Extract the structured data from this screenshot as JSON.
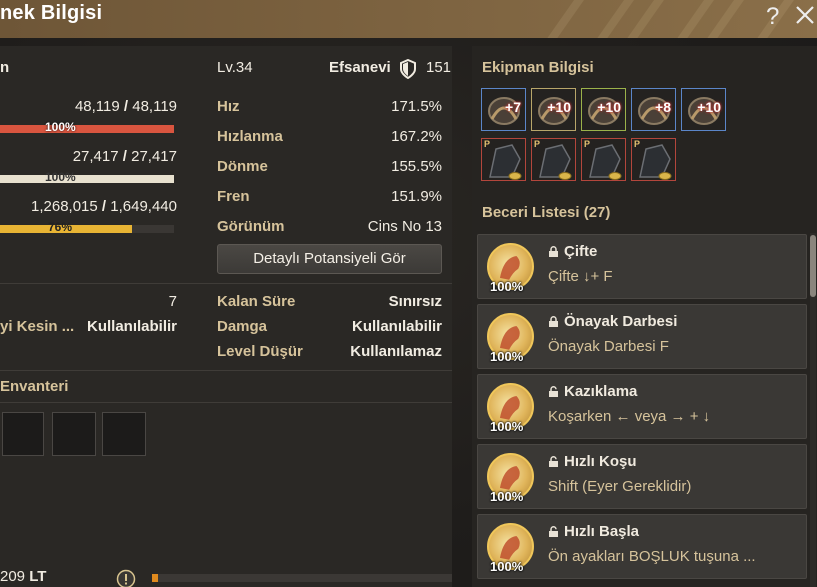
{
  "window": {
    "title": "nek Bilgisi"
  },
  "header": {
    "level": "Lv.34",
    "grade": "Efsanevi",
    "grade_value": "151",
    "name_partial": "n"
  },
  "vitals": [
    {
      "current": "48,119",
      "max": "48,119",
      "percent": 100,
      "percent_label": "100%",
      "color": "#d9553f"
    },
    {
      "current": "27,417",
      "max": "27,417",
      "percent": 100,
      "percent_label": "100%",
      "color": "#e8e1cf"
    },
    {
      "current": "1,268,015",
      "max": "1,649,440",
      "percent": 76,
      "percent_label": "76%",
      "color": "#e8b434"
    }
  ],
  "stats": [
    {
      "label": "Hız",
      "value": "171.5%"
    },
    {
      "label": "Hızlanma",
      "value": "167.2%"
    },
    {
      "label": "Dönme",
      "value": "155.5%"
    },
    {
      "label": "Fren",
      "value": "151.9%"
    }
  ],
  "appearance": {
    "label": "Görünüm",
    "value": "Cins No 13"
  },
  "detail_button": "Detaylı Potansiyeli Gör",
  "left_info": {
    "count": "7",
    "label_partial": "yi Kesin ...",
    "status": "Kullanılabilir"
  },
  "extra": [
    {
      "label": "Kalan Süre",
      "value": "Sınırsız"
    },
    {
      "label": "Damga",
      "value": "Kullanılabilir"
    },
    {
      "label": "Level Düşür",
      "value": "Kullanılamaz"
    }
  ],
  "inventory": {
    "title": "Envanteri"
  },
  "footer": {
    "amount": "209",
    "currency": "LT",
    "progress": 0.02
  },
  "equipment": {
    "title": "Ekipman Bilgisi",
    "row1": [
      {
        "name": "saddle-armor",
        "level": "+7",
        "border": "#5b86c9"
      },
      {
        "name": "horseshoe",
        "level": "+10",
        "border": "#b8a66a"
      },
      {
        "name": "stirrup",
        "level": "+10",
        "border": "#9bb24a"
      },
      {
        "name": "reins",
        "level": "+8",
        "border": "#5b86c9"
      },
      {
        "name": "bridle",
        "level": "+10",
        "border": "#5b86c9"
      }
    ],
    "row2": [
      {
        "name": "head-armor",
        "tag": "P",
        "border": "#b3463c"
      },
      {
        "name": "body-armor",
        "tag": "P",
        "border": "#b3463c"
      },
      {
        "name": "saddle-cloth",
        "tag": "P",
        "border": "#b3463c"
      },
      {
        "name": "leg-armor",
        "tag": "P",
        "border": "#b3463c"
      }
    ]
  },
  "skills": {
    "title": "Beceri Listesi (27)",
    "items": [
      {
        "name": "Çifte",
        "key": "Çifte ↓+ F",
        "percent": "100%",
        "locked": true
      },
      {
        "name": "Önayak Darbesi",
        "key": "Önayak Darbesi F",
        "percent": "100%",
        "locked": true
      },
      {
        "name": "Kazıklama",
        "key": "Koşarken ← veya → + ↓",
        "percent": "100%",
        "locked": false
      },
      {
        "name": "Hızlı Koşu",
        "key": "Shift (Eyer Gereklidir)",
        "percent": "100%",
        "locked": false
      },
      {
        "name": "Hızlı Başla",
        "key": "Ön ayakları BOŞLUK tuşuna ...",
        "percent": "100%",
        "locked": false
      }
    ]
  }
}
